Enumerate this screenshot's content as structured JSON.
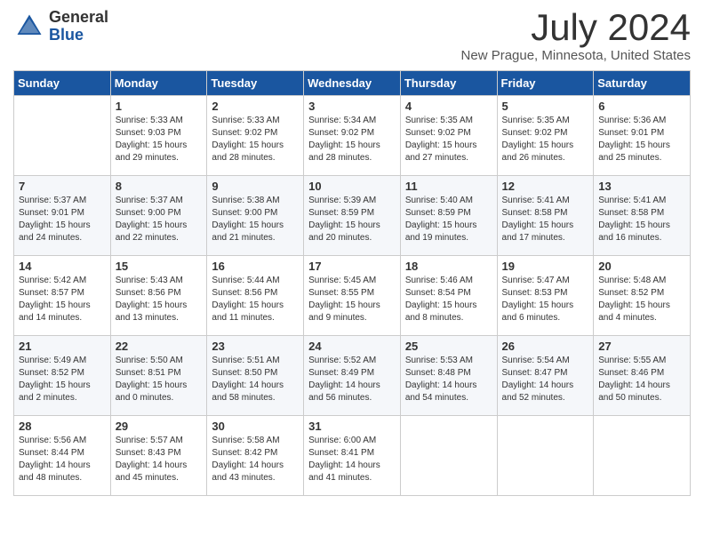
{
  "header": {
    "logo_line1": "General",
    "logo_line2": "Blue",
    "month": "July 2024",
    "location": "New Prague, Minnesota, United States"
  },
  "days_of_week": [
    "Sunday",
    "Monday",
    "Tuesday",
    "Wednesday",
    "Thursday",
    "Friday",
    "Saturday"
  ],
  "weeks": [
    [
      {
        "day": "",
        "info": ""
      },
      {
        "day": "1",
        "info": "Sunrise: 5:33 AM\nSunset: 9:03 PM\nDaylight: 15 hours\nand 29 minutes."
      },
      {
        "day": "2",
        "info": "Sunrise: 5:33 AM\nSunset: 9:02 PM\nDaylight: 15 hours\nand 28 minutes."
      },
      {
        "day": "3",
        "info": "Sunrise: 5:34 AM\nSunset: 9:02 PM\nDaylight: 15 hours\nand 28 minutes."
      },
      {
        "day": "4",
        "info": "Sunrise: 5:35 AM\nSunset: 9:02 PM\nDaylight: 15 hours\nand 27 minutes."
      },
      {
        "day": "5",
        "info": "Sunrise: 5:35 AM\nSunset: 9:02 PM\nDaylight: 15 hours\nand 26 minutes."
      },
      {
        "day": "6",
        "info": "Sunrise: 5:36 AM\nSunset: 9:01 PM\nDaylight: 15 hours\nand 25 minutes."
      }
    ],
    [
      {
        "day": "7",
        "info": "Sunrise: 5:37 AM\nSunset: 9:01 PM\nDaylight: 15 hours\nand 24 minutes."
      },
      {
        "day": "8",
        "info": "Sunrise: 5:37 AM\nSunset: 9:00 PM\nDaylight: 15 hours\nand 22 minutes."
      },
      {
        "day": "9",
        "info": "Sunrise: 5:38 AM\nSunset: 9:00 PM\nDaylight: 15 hours\nand 21 minutes."
      },
      {
        "day": "10",
        "info": "Sunrise: 5:39 AM\nSunset: 8:59 PM\nDaylight: 15 hours\nand 20 minutes."
      },
      {
        "day": "11",
        "info": "Sunrise: 5:40 AM\nSunset: 8:59 PM\nDaylight: 15 hours\nand 19 minutes."
      },
      {
        "day": "12",
        "info": "Sunrise: 5:41 AM\nSunset: 8:58 PM\nDaylight: 15 hours\nand 17 minutes."
      },
      {
        "day": "13",
        "info": "Sunrise: 5:41 AM\nSunset: 8:58 PM\nDaylight: 15 hours\nand 16 minutes."
      }
    ],
    [
      {
        "day": "14",
        "info": "Sunrise: 5:42 AM\nSunset: 8:57 PM\nDaylight: 15 hours\nand 14 minutes."
      },
      {
        "day": "15",
        "info": "Sunrise: 5:43 AM\nSunset: 8:56 PM\nDaylight: 15 hours\nand 13 minutes."
      },
      {
        "day": "16",
        "info": "Sunrise: 5:44 AM\nSunset: 8:56 PM\nDaylight: 15 hours\nand 11 minutes."
      },
      {
        "day": "17",
        "info": "Sunrise: 5:45 AM\nSunset: 8:55 PM\nDaylight: 15 hours\nand 9 minutes."
      },
      {
        "day": "18",
        "info": "Sunrise: 5:46 AM\nSunset: 8:54 PM\nDaylight: 15 hours\nand 8 minutes."
      },
      {
        "day": "19",
        "info": "Sunrise: 5:47 AM\nSunset: 8:53 PM\nDaylight: 15 hours\nand 6 minutes."
      },
      {
        "day": "20",
        "info": "Sunrise: 5:48 AM\nSunset: 8:52 PM\nDaylight: 15 hours\nand 4 minutes."
      }
    ],
    [
      {
        "day": "21",
        "info": "Sunrise: 5:49 AM\nSunset: 8:52 PM\nDaylight: 15 hours\nand 2 minutes."
      },
      {
        "day": "22",
        "info": "Sunrise: 5:50 AM\nSunset: 8:51 PM\nDaylight: 15 hours\nand 0 minutes."
      },
      {
        "day": "23",
        "info": "Sunrise: 5:51 AM\nSunset: 8:50 PM\nDaylight: 14 hours\nand 58 minutes."
      },
      {
        "day": "24",
        "info": "Sunrise: 5:52 AM\nSunset: 8:49 PM\nDaylight: 14 hours\nand 56 minutes."
      },
      {
        "day": "25",
        "info": "Sunrise: 5:53 AM\nSunset: 8:48 PM\nDaylight: 14 hours\nand 54 minutes."
      },
      {
        "day": "26",
        "info": "Sunrise: 5:54 AM\nSunset: 8:47 PM\nDaylight: 14 hours\nand 52 minutes."
      },
      {
        "day": "27",
        "info": "Sunrise: 5:55 AM\nSunset: 8:46 PM\nDaylight: 14 hours\nand 50 minutes."
      }
    ],
    [
      {
        "day": "28",
        "info": "Sunrise: 5:56 AM\nSunset: 8:44 PM\nDaylight: 14 hours\nand 48 minutes."
      },
      {
        "day": "29",
        "info": "Sunrise: 5:57 AM\nSunset: 8:43 PM\nDaylight: 14 hours\nand 45 minutes."
      },
      {
        "day": "30",
        "info": "Sunrise: 5:58 AM\nSunset: 8:42 PM\nDaylight: 14 hours\nand 43 minutes."
      },
      {
        "day": "31",
        "info": "Sunrise: 6:00 AM\nSunset: 8:41 PM\nDaylight: 14 hours\nand 41 minutes."
      },
      {
        "day": "",
        "info": ""
      },
      {
        "day": "",
        "info": ""
      },
      {
        "day": "",
        "info": ""
      }
    ]
  ]
}
